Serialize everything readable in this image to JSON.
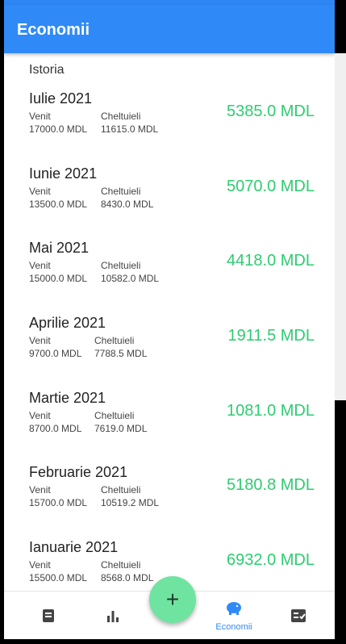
{
  "app": {
    "title": "Economii"
  },
  "history_label": "Istoria",
  "labels": {
    "income": "Venit",
    "expenses": "Cheltuieli"
  },
  "months": [
    {
      "name": "Iulie 2021",
      "income": "17000.0 MDL",
      "expenses": "11615.0 MDL",
      "savings": "5385.0 MDL"
    },
    {
      "name": "Iunie 2021",
      "income": "13500.0 MDL",
      "expenses": "8430.0 MDL",
      "savings": "5070.0 MDL"
    },
    {
      "name": "Mai 2021",
      "income": "15000.0 MDL",
      "expenses": "10582.0 MDL",
      "savings": "4418.0 MDL"
    },
    {
      "name": "Aprilie 2021",
      "income": "9700.0 MDL",
      "expenses": "7788.5 MDL",
      "savings": "1911.5 MDL"
    },
    {
      "name": "Martie 2021",
      "income": "8700.0 MDL",
      "expenses": "7619.0 MDL",
      "savings": "1081.0 MDL"
    },
    {
      "name": "Februarie 2021",
      "income": "15700.0 MDL",
      "expenses": "10519.2 MDL",
      "savings": "5180.8 MDL"
    },
    {
      "name": "Ianuarie 2021",
      "income": "15500.0 MDL",
      "expenses": "8568.0 MDL",
      "savings": "6932.0 MDL"
    }
  ],
  "nav": {
    "items": [
      {
        "icon": "receipt-icon"
      },
      {
        "icon": "bar-chart-icon"
      },
      {
        "icon": "piggy-bank-icon",
        "label": "Economii",
        "active": true
      },
      {
        "icon": "checklist-icon"
      }
    ],
    "fab_icon": "plus-icon",
    "fab_symbol": "+"
  },
  "colors": {
    "accent": "#2f8af7",
    "positive": "#2ecc71",
    "fab": "#6ee4a0"
  }
}
